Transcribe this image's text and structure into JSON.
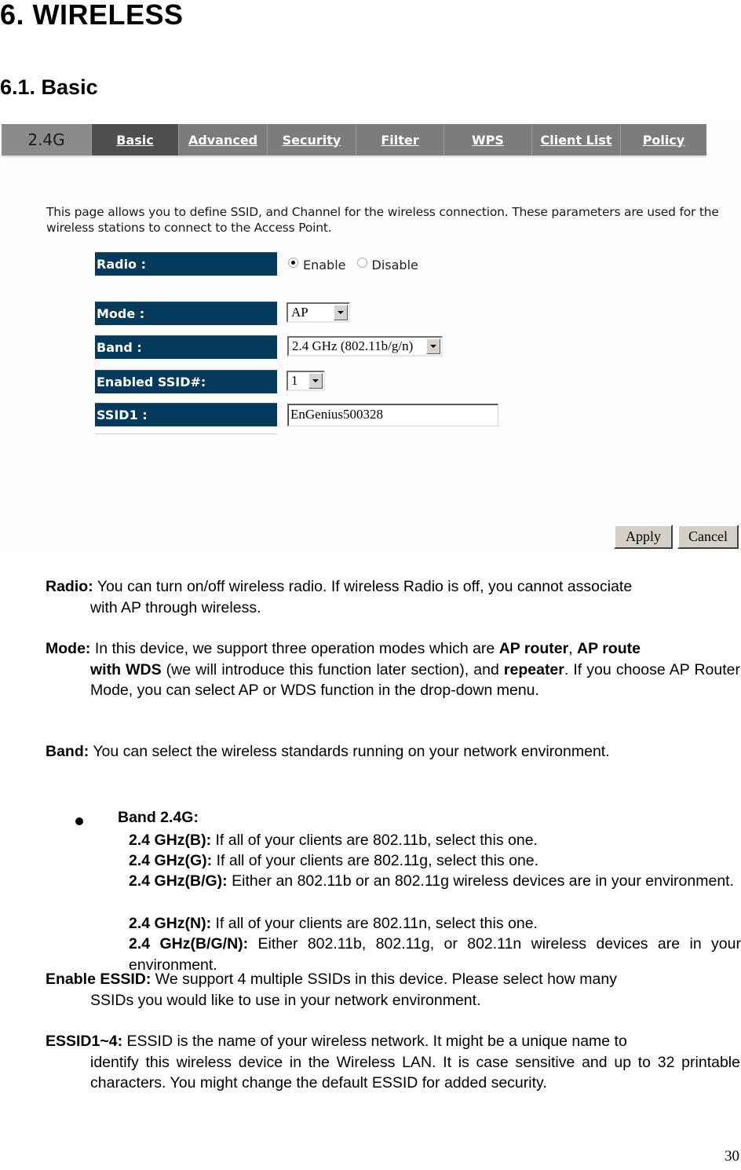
{
  "heading": "6. WIRELESS",
  "subheading": "6.1. Basic",
  "screenshot": {
    "tabs": [
      {
        "label": "2.4G",
        "type": "band"
      },
      {
        "label": "Basic",
        "active": true
      },
      {
        "label": "Advanced"
      },
      {
        "label": "Security"
      },
      {
        "label": "Filter"
      },
      {
        "label": "WPS"
      },
      {
        "label": "Client List"
      },
      {
        "label": "Policy"
      }
    ],
    "intro": "This page allows you to define SSID, and Channel for the wireless connection. These parameters are used for the wireless stations to connect to the Access Point.",
    "fields": {
      "radio_label": "Radio :",
      "radio_options": [
        "Enable",
        "Disable"
      ],
      "radio_selected": "Enable",
      "mode_label": "Mode :",
      "mode_value": "AP",
      "band_label": "Band :",
      "band_value": "2.4 GHz (802.11b/g/n)",
      "enabled_ssid_label": "Enabled SSID#:",
      "enabled_ssid_value": "1",
      "ssid1_label": "SSID1 :",
      "ssid1_value": "EnGenius500328"
    },
    "buttons": {
      "apply": "Apply",
      "cancel": "Cancel"
    }
  },
  "body": {
    "radio": {
      "term": "Radio:",
      "text_1": " You can turn on/off wireless radio. If wireless Radio is off, you cannot associate",
      "text_2": "with AP through wireless."
    },
    "mode": {
      "term": "Mode:",
      "text_a": " In this device, we support three operation modes which are ",
      "b1": "AP router",
      "text_b": ", ",
      "b2a": "AP route",
      "b2b": "with WDS",
      "text_c": " (we will introduce this function later section), and ",
      "b3": "repeater",
      "text_d": ". If you choose AP Router Mode, you can select AP or WDS function in the drop-down menu."
    },
    "band": {
      "term": "Band:",
      "text": " You can select the wireless standards running on your network environment.",
      "bullet": "Band 2.4G:",
      "items": [
        {
          "term": "2.4 GHz(B):",
          "text": " If all of your clients are 802.11b, select this one."
        },
        {
          "term": "2.4 GHz(G):",
          "text": " If all of your clients are 802.11g, select this one."
        },
        {
          "term": "2.4 GHz(B/G):",
          "text": " Either an 802.11b or an 802.11g wireless devices are in your environment."
        },
        {
          "term": "2.4 GHz(N):",
          "text": " If all of your clients are 802.11n, select this one."
        },
        {
          "term": "2.4 GHz(B/G/N):",
          "text": " Either 802.11b, 802.11g, or 802.11n wireless devices are in your environment."
        }
      ]
    },
    "enable_essid": {
      "term": "Enable ESSID:",
      "text_1": " We support 4 multiple SSIDs in this device. Please select how many",
      "text_2": "SSIDs you would like to use in your network environment."
    },
    "essid": {
      "term": "ESSID1~4:",
      "text_1": " ESSID is the name of your wireless network. It might be a unique name to",
      "text_2": "identify this wireless device in the Wireless LAN. It is case sensitive and up to 32 printable characters. You might change the default ESSID for added security."
    }
  },
  "page_number": "30"
}
